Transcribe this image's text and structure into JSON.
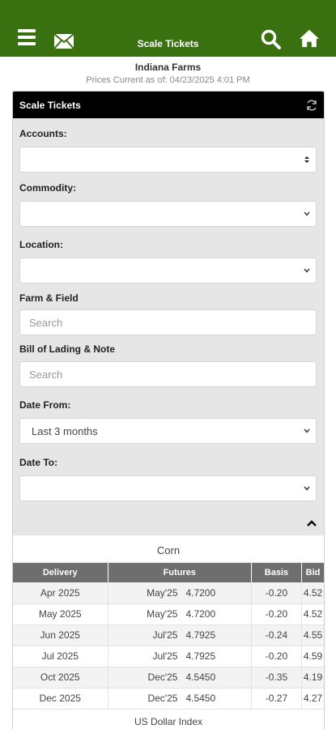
{
  "header": {
    "title": "Scale Tickets"
  },
  "company": {
    "name": "Indiana Farms",
    "prices_current": "Prices Current as of: 04/23/2025 4:01 PM"
  },
  "panel": {
    "title": "Scale Tickets"
  },
  "form": {
    "accounts_label": "Accounts:",
    "commodity_label": "Commodity:",
    "location_label": "Location:",
    "farm_label": "Farm & Field",
    "farm_placeholder": "Search",
    "bol_label": "Bill of Lading & Note",
    "bol_placeholder": "Search",
    "date_from_label": "Date From:",
    "date_from_value": "Last 3 months",
    "date_to_label": "Date To:"
  },
  "corn": {
    "title": "Corn",
    "headers": [
      "Delivery",
      "Futures",
      "Basis",
      "Bid"
    ],
    "rows": [
      {
        "delivery": "Apr 2025",
        "month": "May'25",
        "futures": "4.7200",
        "basis": "-0.20",
        "bid": "4.52"
      },
      {
        "delivery": "May 2025",
        "month": "May'25",
        "futures": "4.7200",
        "basis": "-0.20",
        "bid": "4.52"
      },
      {
        "delivery": "Jun 2025",
        "month": "Jul'25",
        "futures": "4.7925",
        "basis": "-0.24",
        "bid": "4.55"
      },
      {
        "delivery": "Jul 2025",
        "month": "Jul'25",
        "futures": "4.7925",
        "basis": "-0.20",
        "bid": "4.59"
      },
      {
        "delivery": "Oct 2025",
        "month": "Dec'25",
        "futures": "4.5450",
        "basis": "-0.35",
        "bid": "4.19"
      },
      {
        "delivery": "Dec 2025",
        "month": "Dec'25",
        "futures": "4.5450",
        "basis": "-0.27",
        "bid": "4.27"
      }
    ]
  },
  "next_section": {
    "title": "US Dollar Index"
  },
  "colors": {
    "brand_green": "#3a7110",
    "panel_header": "#000000",
    "table_header": "#6e6e6e"
  }
}
